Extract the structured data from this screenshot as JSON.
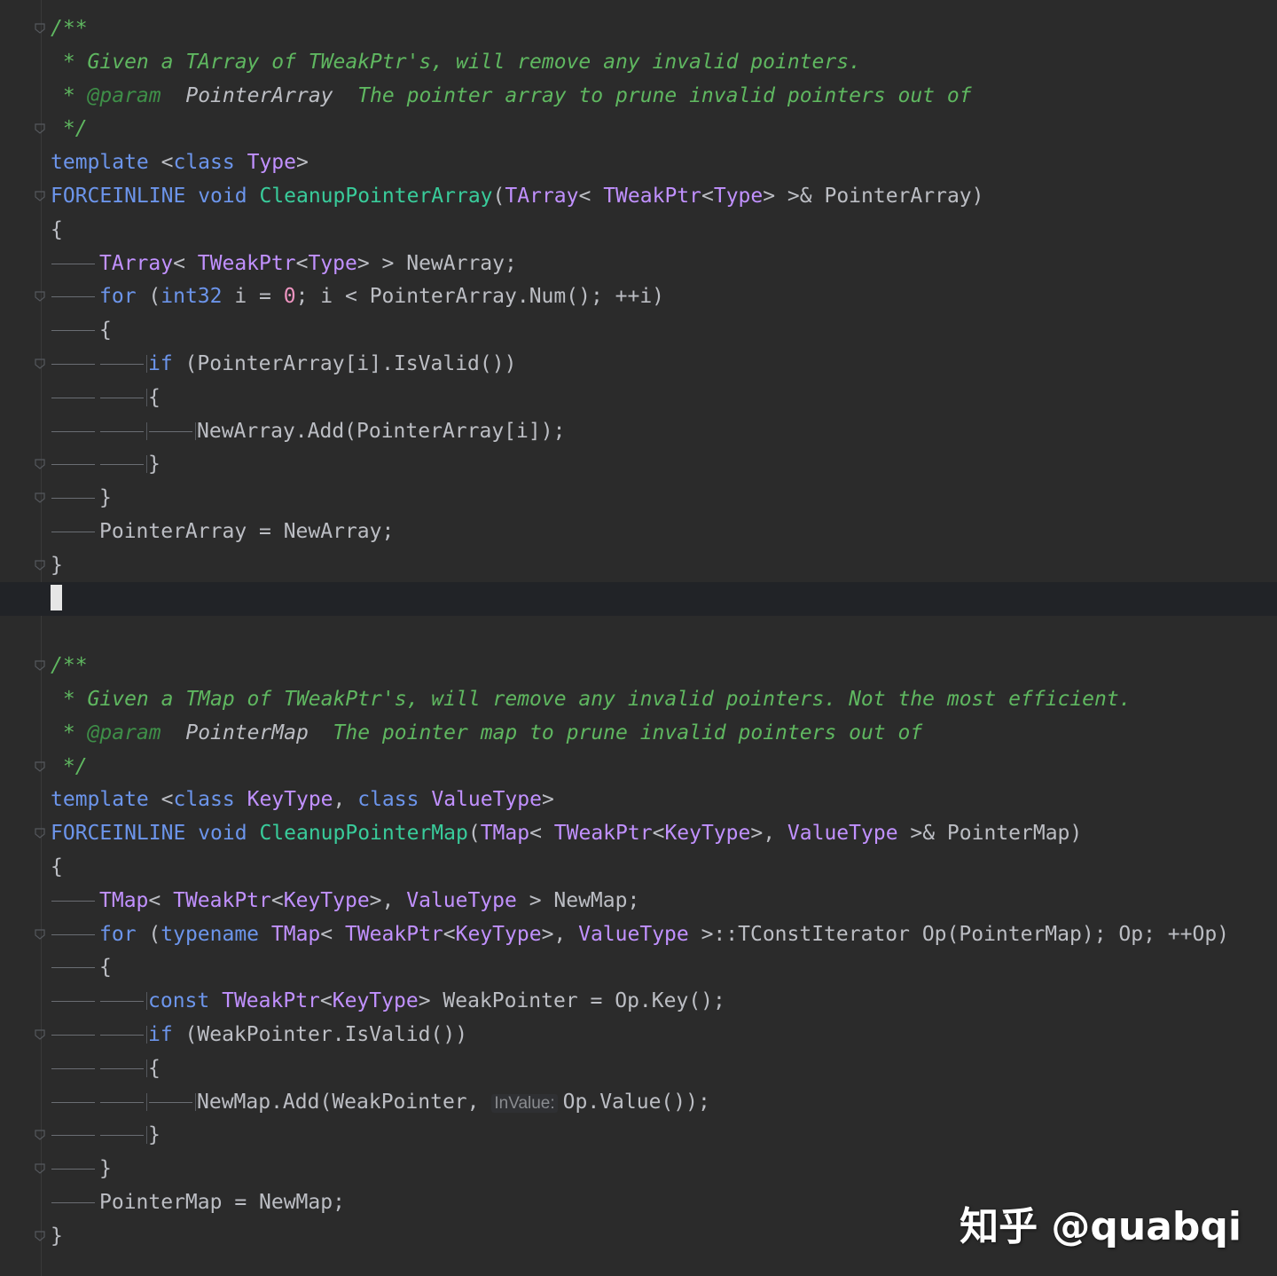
{
  "lines": [
    {
      "fold": true,
      "spans": [
        {
          "t": "/**",
          "c": "cm"
        }
      ]
    },
    {
      "spans": [
        {
          "t": " * Given a TArray of TWeakPtr's, will remove any invalid pointers.",
          "c": "cm"
        }
      ]
    },
    {
      "spans": [
        {
          "t": " * ",
          "c": "cm"
        },
        {
          "t": "@param",
          "c": "cmtag"
        },
        {
          "t": "  ",
          "c": "cm"
        },
        {
          "t": "PointerArray",
          "c": "pl",
          "i": 1
        },
        {
          "t": "  The pointer array to prune invalid pointers out of",
          "c": "cm"
        }
      ]
    },
    {
      "fold": true,
      "spans": [
        {
          "t": " */",
          "c": "cm"
        }
      ]
    },
    {
      "spans": [
        {
          "t": "template",
          "c": "kw"
        },
        {
          "t": " <",
          "c": "pl"
        },
        {
          "t": "class",
          "c": "kw"
        },
        {
          "t": " ",
          "c": "pl"
        },
        {
          "t": "Type",
          "c": "ty"
        },
        {
          "t": ">",
          "c": "pl"
        }
      ]
    },
    {
      "fold": true,
      "spans": [
        {
          "t": "FORCEINLINE",
          "c": "kw"
        },
        {
          "t": " ",
          "c": "pl"
        },
        {
          "t": "void",
          "c": "kw"
        },
        {
          "t": " ",
          "c": "pl"
        },
        {
          "t": "CleanupPointerArray",
          "c": "fn"
        },
        {
          "t": "(",
          "c": "pl"
        },
        {
          "t": "TArray",
          "c": "ty"
        },
        {
          "t": "< ",
          "c": "pl"
        },
        {
          "t": "TWeakPtr",
          "c": "ty"
        },
        {
          "t": "<",
          "c": "pl"
        },
        {
          "t": "Type",
          "c": "ty"
        },
        {
          "t": "> >& PointerArray)",
          "c": "pl"
        }
      ]
    },
    {
      "spans": [
        {
          "t": "{",
          "c": "pl"
        }
      ]
    },
    {
      "indent": 1,
      "spans": [
        {
          "t": "TArray",
          "c": "ty"
        },
        {
          "t": "< ",
          "c": "pl"
        },
        {
          "t": "TWeakPtr",
          "c": "ty"
        },
        {
          "t": "<",
          "c": "pl"
        },
        {
          "t": "Type",
          "c": "ty"
        },
        {
          "t": "> > NewArray;",
          "c": "pl"
        }
      ]
    },
    {
      "fold": true,
      "indent": 1,
      "spans": [
        {
          "t": "for",
          "c": "kw"
        },
        {
          "t": " (",
          "c": "pl"
        },
        {
          "t": "int32",
          "c": "kw"
        },
        {
          "t": " i = ",
          "c": "pl"
        },
        {
          "t": "0",
          "c": "num"
        },
        {
          "t": "; i < PointerArray.Num(); ++i)",
          "c": "pl"
        }
      ]
    },
    {
      "indent": 1,
      "spans": [
        {
          "t": "{",
          "c": "pl"
        }
      ]
    },
    {
      "fold": true,
      "indent": 2,
      "spans": [
        {
          "t": "if",
          "c": "kw"
        },
        {
          "t": " (PointerArray[i].IsValid())",
          "c": "pl"
        }
      ]
    },
    {
      "indent": 2,
      "spans": [
        {
          "t": "{",
          "c": "pl"
        }
      ]
    },
    {
      "indent": 3,
      "spans": [
        {
          "t": "NewArray.Add(PointerArray[i]);",
          "c": "pl"
        }
      ]
    },
    {
      "fold": true,
      "indent": 2,
      "spans": [
        {
          "t": "}",
          "c": "pl"
        }
      ]
    },
    {
      "fold": true,
      "indent": 1,
      "spans": [
        {
          "t": "}",
          "c": "pl"
        }
      ]
    },
    {
      "indent": 1,
      "spans": [
        {
          "t": "PointerArray = NewArray;",
          "c": "pl"
        }
      ]
    },
    {
      "fold": true,
      "spans": [
        {
          "t": "}",
          "c": "pl"
        }
      ]
    },
    {
      "current": true,
      "spans": []
    },
    {
      "spans": []
    },
    {
      "fold": true,
      "spans": [
        {
          "t": "/**",
          "c": "cm"
        }
      ]
    },
    {
      "spans": [
        {
          "t": " * Given a TMap of TWeakPtr's, will remove any invalid pointers. Not the most efficient.",
          "c": "cm"
        }
      ]
    },
    {
      "spans": [
        {
          "t": " * ",
          "c": "cm"
        },
        {
          "t": "@param",
          "c": "cmtag"
        },
        {
          "t": "  ",
          "c": "cm"
        },
        {
          "t": "PointerMap",
          "c": "pl",
          "i": 1
        },
        {
          "t": "  The pointer map to prune invalid pointers out of",
          "c": "cm"
        }
      ]
    },
    {
      "fold": true,
      "spans": [
        {
          "t": " */",
          "c": "cm"
        }
      ]
    },
    {
      "spans": [
        {
          "t": "template",
          "c": "kw"
        },
        {
          "t": " <",
          "c": "pl"
        },
        {
          "t": "class",
          "c": "kw"
        },
        {
          "t": " ",
          "c": "pl"
        },
        {
          "t": "KeyType",
          "c": "ty"
        },
        {
          "t": ", ",
          "c": "pl"
        },
        {
          "t": "class",
          "c": "kw"
        },
        {
          "t": " ",
          "c": "pl"
        },
        {
          "t": "ValueType",
          "c": "ty"
        },
        {
          "t": ">",
          "c": "pl"
        }
      ]
    },
    {
      "fold": true,
      "spans": [
        {
          "t": "FORCEINLINE",
          "c": "kw"
        },
        {
          "t": " ",
          "c": "pl"
        },
        {
          "t": "void",
          "c": "kw"
        },
        {
          "t": " ",
          "c": "pl"
        },
        {
          "t": "CleanupPointerMap",
          "c": "fn"
        },
        {
          "t": "(",
          "c": "pl"
        },
        {
          "t": "TMap",
          "c": "ty"
        },
        {
          "t": "< ",
          "c": "pl"
        },
        {
          "t": "TWeakPtr",
          "c": "ty"
        },
        {
          "t": "<",
          "c": "pl"
        },
        {
          "t": "KeyType",
          "c": "ty"
        },
        {
          "t": ">, ",
          "c": "pl"
        },
        {
          "t": "ValueType",
          "c": "ty"
        },
        {
          "t": " >& PointerMap)",
          "c": "pl"
        }
      ]
    },
    {
      "spans": [
        {
          "t": "{",
          "c": "pl"
        }
      ]
    },
    {
      "indent": 1,
      "spans": [
        {
          "t": "TMap",
          "c": "ty"
        },
        {
          "t": "< ",
          "c": "pl"
        },
        {
          "t": "TWeakPtr",
          "c": "ty"
        },
        {
          "t": "<",
          "c": "pl"
        },
        {
          "t": "KeyType",
          "c": "ty"
        },
        {
          "t": ">, ",
          "c": "pl"
        },
        {
          "t": "ValueType",
          "c": "ty"
        },
        {
          "t": " > NewMap;",
          "c": "pl"
        }
      ]
    },
    {
      "fold": true,
      "indent": 1,
      "spans": [
        {
          "t": "for",
          "c": "kw"
        },
        {
          "t": " (",
          "c": "pl"
        },
        {
          "t": "typename",
          "c": "kw"
        },
        {
          "t": " ",
          "c": "pl"
        },
        {
          "t": "TMap",
          "c": "ty"
        },
        {
          "t": "< ",
          "c": "pl"
        },
        {
          "t": "TWeakPtr",
          "c": "ty"
        },
        {
          "t": "<",
          "c": "pl"
        },
        {
          "t": "KeyType",
          "c": "ty"
        },
        {
          "t": ">, ",
          "c": "pl"
        },
        {
          "t": "ValueType",
          "c": "ty"
        },
        {
          "t": " >::TConstIterator Op(PointerMap); Op; ++Op)",
          "c": "pl"
        }
      ]
    },
    {
      "indent": 1,
      "spans": [
        {
          "t": "{",
          "c": "pl"
        }
      ]
    },
    {
      "indent": 2,
      "spans": [
        {
          "t": "const",
          "c": "kw"
        },
        {
          "t": " ",
          "c": "pl"
        },
        {
          "t": "TWeakPtr",
          "c": "ty"
        },
        {
          "t": "<",
          "c": "pl"
        },
        {
          "t": "KeyType",
          "c": "ty"
        },
        {
          "t": "> WeakPointer = Op.Key();",
          "c": "pl"
        }
      ]
    },
    {
      "fold": true,
      "indent": 2,
      "spans": [
        {
          "t": "if",
          "c": "kw"
        },
        {
          "t": " (WeakPointer.IsValid())",
          "c": "pl"
        }
      ]
    },
    {
      "indent": 2,
      "spans": [
        {
          "t": "{",
          "c": "pl"
        }
      ]
    },
    {
      "indent": 3,
      "spans": [
        {
          "t": "NewMap.Add(WeakPointer, ",
          "c": "pl"
        },
        {
          "t": "InValue:",
          "c": "hint"
        },
        {
          "t": "Op.Value());",
          "c": "pl"
        }
      ]
    },
    {
      "fold": true,
      "indent": 2,
      "spans": [
        {
          "t": "}",
          "c": "pl"
        }
      ]
    },
    {
      "fold": true,
      "indent": 1,
      "spans": [
        {
          "t": "}",
          "c": "pl"
        }
      ]
    },
    {
      "indent": 1,
      "spans": [
        {
          "t": "PointerMap = NewMap;",
          "c": "pl"
        }
      ]
    },
    {
      "fold": true,
      "spans": [
        {
          "t": "}",
          "c": "pl"
        }
      ]
    }
  ],
  "watermark": "知乎 @quabqi"
}
